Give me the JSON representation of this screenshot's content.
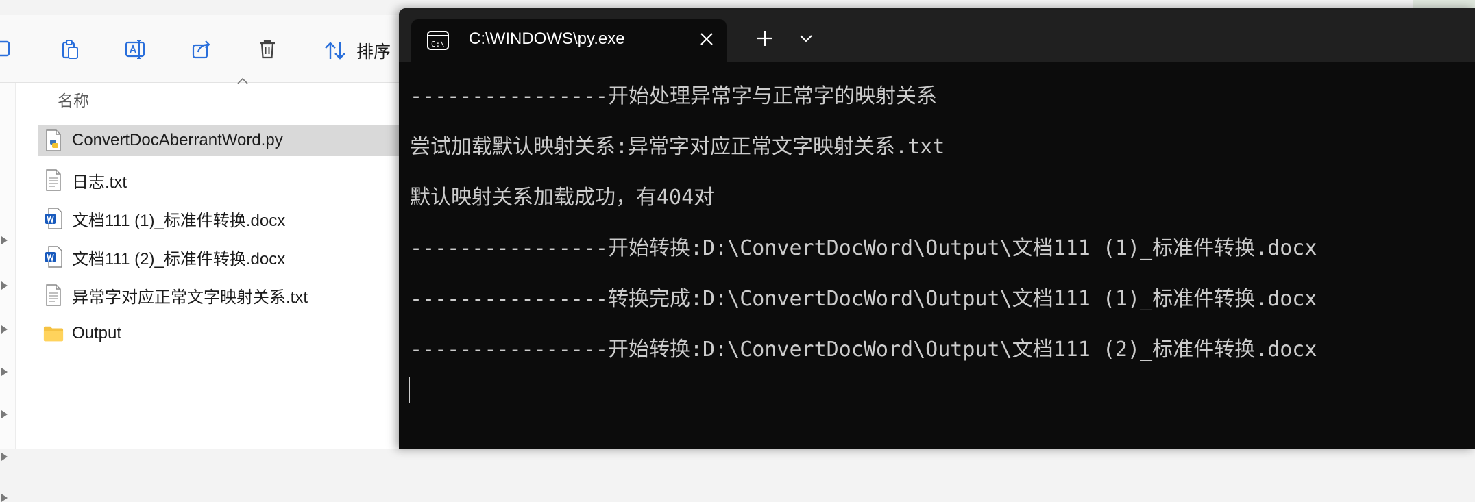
{
  "explorer": {
    "toolbar": {
      "sort_label": "排序"
    },
    "column_header": "名称",
    "files": [
      {
        "name": "ConvertDocAberrantWord.py",
        "type": "python",
        "selected": true
      },
      {
        "name": "日志.txt",
        "type": "text",
        "selected": false
      },
      {
        "name": "文档111 (1)_标准件转换.docx",
        "type": "word",
        "selected": false
      },
      {
        "name": "文档111 (2)_标准件转换.docx",
        "type": "word",
        "selected": false
      },
      {
        "name": "异常字对应正常文字映射关系.txt",
        "type": "text",
        "selected": false
      },
      {
        "name": "Output",
        "type": "folder",
        "selected": false
      }
    ]
  },
  "terminal": {
    "tab_title": "C:\\WINDOWS\\py.exe",
    "lines": [
      "----------------开始处理异常字与正常字的映射关系",
      "尝试加载默认映射关系:异常字对应正常文字映射关系.txt",
      "默认映射关系加载成功，有404对",
      "----------------开始转换:D:\\ConvertDocWord\\Output\\文档111 (1)_标准件转换.docx",
      "----------------转换完成:D:\\ConvertDocWord\\Output\\文档111 (1)_标准件转换.docx",
      "----------------开始转换:D:\\ConvertDocWord\\Output\\文档111 (2)_标准件转换.docx"
    ]
  },
  "icons": {
    "copy": "copy-icon",
    "paste": "paste-icon",
    "rename": "rename-icon",
    "share": "share-icon",
    "delete": "delete-icon",
    "sort": "sort-arrows-icon",
    "terminal": "terminal-app-icon",
    "close": "close-icon",
    "new_tab": "plus-icon",
    "dropdown": "chevron-down-icon"
  },
  "colors": {
    "terminal_bg": "#0c0c0c",
    "terminal_text": "#cccccc",
    "titlebar": "#202020",
    "selection": "#d9d9d9",
    "folder": "#f5c242",
    "word_blue": "#185abd"
  }
}
